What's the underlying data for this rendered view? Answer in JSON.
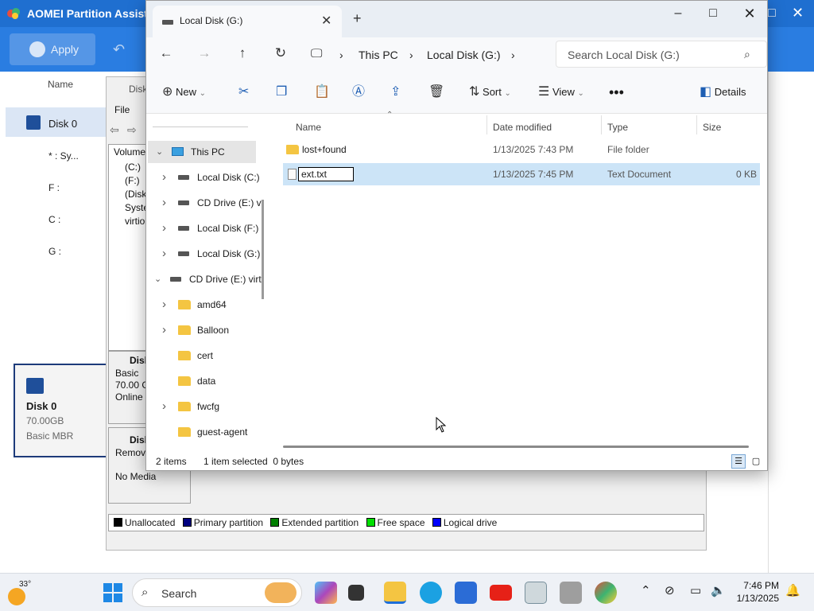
{
  "aomei": {
    "title": "AOMEI Partition Assistant",
    "apply_label": "Apply",
    "column_name": "Name",
    "disk_label": "Disk 0",
    "partitions": [
      "* : Sy...",
      "F :",
      "C :",
      "G :"
    ],
    "card": {
      "name": "Disk 0",
      "size": "70.00GB",
      "type": "Basic MBR"
    }
  },
  "diskmgmt": {
    "title": "Disk",
    "menu_file": "File",
    "volume_header": "Volume",
    "volumes": [
      "(C:)",
      "(F:)",
      "(Disk",
      "Syste",
      "virtio"
    ],
    "disk_block": {
      "title": "Disk",
      "type": "Basic",
      "size": "70.00 G",
      "status": "Online"
    },
    "cd_block": {
      "title": "Disk",
      "type": "Remov",
      "status": "No Media"
    },
    "legend": [
      {
        "label": "Unallocated",
        "color": "#000000"
      },
      {
        "label": "Primary partition",
        "color": "#000080"
      },
      {
        "label": "Extended partition",
        "color": "#008000"
      },
      {
        "label": "Free space",
        "color": "#00e000"
      },
      {
        "label": "Logical drive",
        "color": "#0000ff"
      }
    ]
  },
  "explorer": {
    "tab_title": "Local Disk (G:)",
    "breadcrumb": [
      "This PC",
      "Local Disk (G:)"
    ],
    "search_placeholder": "Search Local Disk (G:)",
    "toolbar": {
      "new": "New",
      "sort": "Sort",
      "view": "View",
      "details": "Details"
    },
    "nav": [
      {
        "label": "This PC",
        "level": 0,
        "icon": "pc",
        "expanded": true,
        "selected": true
      },
      {
        "label": "Local Disk (C:)",
        "level": 1,
        "icon": "drive",
        "chevron": true
      },
      {
        "label": "CD Drive (E:) v",
        "level": 1,
        "icon": "drive",
        "chevron": true
      },
      {
        "label": "Local Disk (F:)",
        "level": 1,
        "icon": "drive",
        "chevron": true
      },
      {
        "label": "Local Disk (G:)",
        "level": 1,
        "icon": "drive",
        "chevron": true
      },
      {
        "label": "CD Drive (E:) virt",
        "level": 0,
        "icon": "drive",
        "expanded": true
      },
      {
        "label": "amd64",
        "level": 1,
        "icon": "folder",
        "chevron": true
      },
      {
        "label": "Balloon",
        "level": 1,
        "icon": "folder",
        "chevron": true
      },
      {
        "label": "cert",
        "level": 1,
        "icon": "folder"
      },
      {
        "label": "data",
        "level": 1,
        "icon": "folder"
      },
      {
        "label": "fwcfg",
        "level": 1,
        "icon": "folder",
        "chevron": true
      },
      {
        "label": "guest-agent",
        "level": 1,
        "icon": "folder"
      }
    ],
    "columns": {
      "name": "Name",
      "date": "Date modified",
      "type": "Type",
      "size": "Size"
    },
    "files": [
      {
        "name": "lost+found",
        "date": "1/13/2025 7:43 PM",
        "type": "File folder",
        "size": "",
        "icon": "folder"
      },
      {
        "name": "ext.txt",
        "date": "1/13/2025 7:45 PM",
        "type": "Text Document",
        "size": "0 KB",
        "icon": "text",
        "selected": true,
        "renaming": true
      }
    ],
    "status": {
      "items": "2 items",
      "selected": "1 item selected  0 bytes"
    }
  },
  "taskbar": {
    "weather_temp": "33°",
    "search_placeholder": "Search",
    "time": "7:46 PM",
    "date": "1/13/2025"
  }
}
